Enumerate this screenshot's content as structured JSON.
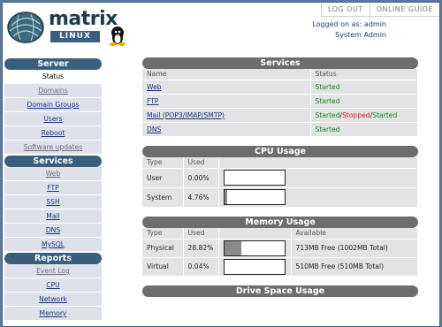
{
  "logo": {
    "brand": "matrix",
    "sub": "LINUX"
  },
  "topnav": {
    "logout": "LOG OUT",
    "guide": "ONLINE GUIDE"
  },
  "login": {
    "line1": "Logged on as: admin",
    "line2": "System Admin"
  },
  "sidebar": {
    "sections": [
      {
        "title": "Server",
        "items": [
          "Status",
          "Domains",
          "Domain Groups",
          "Users",
          "Reboot",
          "Software updates"
        ]
      },
      {
        "title": "Services",
        "items": [
          "Web",
          "FTP",
          "SSH",
          "Mail",
          "DNS",
          "MySQL"
        ]
      },
      {
        "title": "Reports",
        "items": [
          "Event Log",
          "CPU",
          "Network",
          "Memory"
        ]
      }
    ]
  },
  "services": {
    "title": "Services",
    "headers": [
      "Name",
      "Status"
    ],
    "rows": [
      {
        "name": "Web",
        "status": "Started"
      },
      {
        "name": "FTP",
        "status": "Started"
      },
      {
        "name": "Mail (POP3/IMAP/SMTP)",
        "status_parts": [
          "Started",
          "/",
          "Stopped",
          "/",
          "Started"
        ]
      },
      {
        "name": "DNS",
        "status": "Started"
      }
    ]
  },
  "cpu": {
    "title": "CPU Usage",
    "headers": [
      "Type",
      "Used",
      ""
    ],
    "rows": [
      {
        "type": "User",
        "used": "0.00%",
        "fraction": 0.0
      },
      {
        "type": "System",
        "used": "4.76%",
        "fraction": 0.0476
      }
    ]
  },
  "memory": {
    "title": "Memory Usage",
    "headers": [
      "Type",
      "Used",
      "",
      "Available"
    ],
    "rows": [
      {
        "type": "Physical",
        "used": "28.82%",
        "fraction": 0.2882,
        "available": "713MB Free (1002MB Total)"
      },
      {
        "type": "Virtual",
        "used": "0.04%",
        "fraction": 0.0004,
        "available": "510MB Free (510MB Total)"
      }
    ]
  },
  "drive": {
    "title": "Drive Space Usage"
  },
  "colors": {
    "frame": "#5a7a9c",
    "section_head": "#3a5f7e",
    "panel_head": "#6d6d6d",
    "started": "#12860e",
    "stopped": "#d61a1a",
    "link": "#1a3480"
  }
}
